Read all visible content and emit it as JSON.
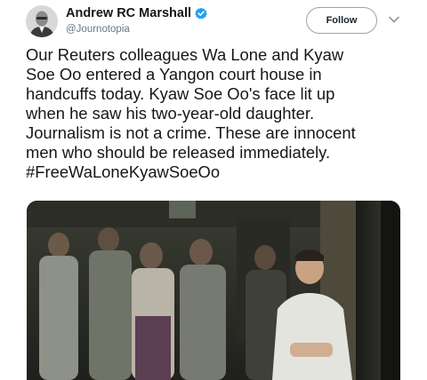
{
  "author": {
    "display_name": "Andrew RC Marshall",
    "handle": "@Journotopia",
    "verified": true
  },
  "header": {
    "follow_label": "Follow",
    "more_icon": "chevron-down-icon"
  },
  "tweet": {
    "lines": [
      "Our Reuters colleagues Wa Lone and Kyaw",
      "Soe Oo entered a Yangon court house in",
      "handcuffs today. Kyaw Soe Oo's face lit up",
      "when he saw his two-year-old daughter.",
      "Journalism is not a crime. These are innocent",
      "men who should be released immediately."
    ],
    "hashtag": "#FreeWaLoneKyawSoeOo"
  },
  "colors": {
    "verified_badge": "#1da1f2",
    "handle_text": "#657786",
    "follow_border": "#9aa4ad"
  }
}
